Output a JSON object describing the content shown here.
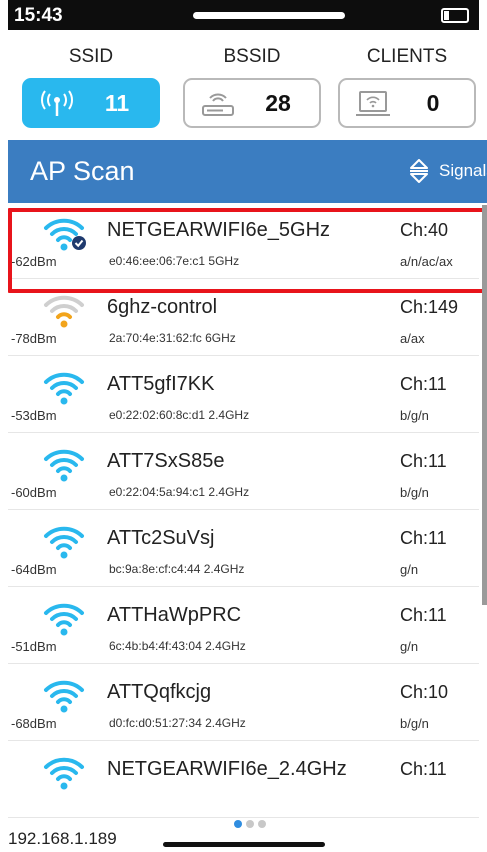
{
  "status_bar": {
    "time": "15:43"
  },
  "counters": [
    {
      "label": "SSID",
      "value": "11",
      "active": true
    },
    {
      "label": "BSSID",
      "value": "28",
      "active": false
    },
    {
      "label": "CLIENTS",
      "value": "0",
      "active": false
    }
  ],
  "header": {
    "title": "AP Scan",
    "sort_label": "Signals"
  },
  "access_points": [
    {
      "ssid": "NETGEARWIFI6e_5GHz",
      "dbm": "-62dBm",
      "bssid": "e0:46:ee:06:7e:c1 5GHz",
      "channel": "Ch:40",
      "mode": "a/n/ac/ax",
      "signal_color": "#29b8ee",
      "connected": true
    },
    {
      "ssid": "6ghz-control",
      "dbm": "-78dBm",
      "bssid": "2a:70:4e:31:62:fc 6GHz",
      "channel": "Ch:149",
      "mode": "a/ax",
      "signal_color": "#f2a41b",
      "connected": false
    },
    {
      "ssid": "ATT5gfI7KK",
      "dbm": "-53dBm",
      "bssid": "e0:22:02:60:8c:d1 2.4GHz",
      "channel": "Ch:11",
      "mode": "b/g/n",
      "signal_color": "#29b8ee",
      "connected": false
    },
    {
      "ssid": "ATT7SxS85e",
      "dbm": "-60dBm",
      "bssid": "e0:22:04:5a:94:c1 2.4GHz",
      "channel": "Ch:11",
      "mode": "b/g/n",
      "signal_color": "#29b8ee",
      "connected": false
    },
    {
      "ssid": "ATTc2SuVsj",
      "dbm": "-64dBm",
      "bssid": "bc:9a:8e:cf:c4:44 2.4GHz",
      "channel": "Ch:11",
      "mode": "g/n",
      "signal_color": "#29b8ee",
      "connected": false
    },
    {
      "ssid": "ATTHaWpPRC",
      "dbm": "-51dBm",
      "bssid": "6c:4b:b4:4f:43:04 2.4GHz",
      "channel": "Ch:11",
      "mode": "g/n",
      "signal_color": "#29b8ee",
      "connected": false
    },
    {
      "ssid": "ATTQqfkcjg",
      "dbm": "-68dBm",
      "bssid": "d0:fc:d0:51:27:34 2.4GHz",
      "channel": "Ch:10",
      "mode": "b/g/n",
      "signal_color": "#29b8ee",
      "connected": false
    },
    {
      "ssid": "NETGEARWIFI6e_2.4GHz",
      "dbm": "",
      "bssid": "",
      "channel": "Ch:11",
      "mode": "",
      "signal_color": "#29b8ee",
      "connected": false
    }
  ],
  "footer": {
    "ip": "192.168.1.189"
  },
  "page_indicator": {
    "pages": 3,
    "current": 1
  },
  "colors": {
    "accent": "#29b8ee",
    "header": "#3b7dc1",
    "highlight": "#e8141b",
    "weak_signal": "#f2a41b"
  }
}
